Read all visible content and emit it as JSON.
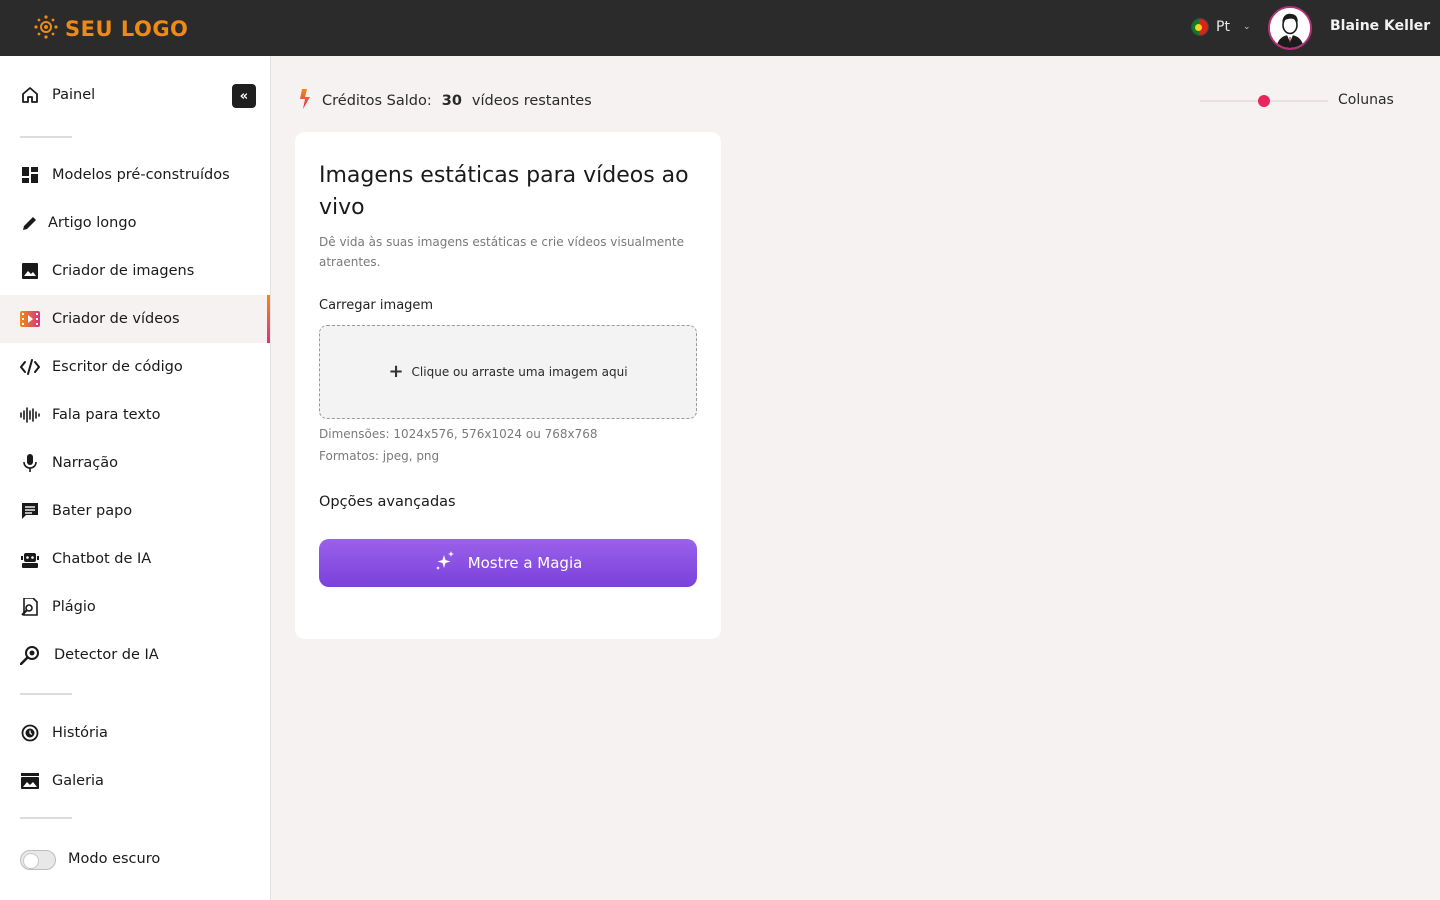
{
  "header": {
    "logo_text": "SEU LOGO",
    "language": "Pt",
    "user_name": "Blaine Keller"
  },
  "sidebar": {
    "items": [
      {
        "label": "Painel",
        "icon": "home-icon"
      },
      {
        "label": "Modelos pré-construídos",
        "icon": "grid-icon"
      },
      {
        "label": "Artigo longo",
        "icon": "pen-icon"
      },
      {
        "label": "Criador de imagens",
        "icon": "image-icon"
      },
      {
        "label": "Criador de vídeos",
        "icon": "video-icon",
        "active": true
      },
      {
        "label": "Escritor de código",
        "icon": "code-icon"
      },
      {
        "label": "Fala para texto",
        "icon": "waveform-icon"
      },
      {
        "label": "Narração",
        "icon": "microphone-icon"
      },
      {
        "label": "Bater papo",
        "icon": "chat-icon"
      },
      {
        "label": "Chatbot de IA",
        "icon": "robot-icon"
      },
      {
        "label": "Plágio",
        "icon": "plagiarism-icon"
      },
      {
        "label": "Detector de IA",
        "icon": "magnifier-icon"
      },
      {
        "label": "História",
        "icon": "history-icon"
      },
      {
        "label": "Galeria",
        "icon": "gallery-icon"
      }
    ],
    "dark_mode_label": "Modo escuro",
    "dark_mode_on": false
  },
  "main": {
    "credits_label": "Créditos Saldo:",
    "credits_value": "30",
    "credits_suffix": "vídeos restantes",
    "columns_label": "Colunas",
    "columns_level": 0.5,
    "card": {
      "title": "Imagens estáticas para vídeos ao vivo",
      "description": "Dê vida às suas imagens estáticas e crie vídeos visualmente atraentes.",
      "upload_label": "Carregar imagem",
      "dropzone_text": "Clique ou arraste uma imagem aqui",
      "dimensions_hint": "Dimensões: 1024x576, 576x1024 ou 768x768",
      "formats_hint": "Formatos: jpeg, png",
      "advanced_label": "Opções avançadas",
      "submit_label": "Mostre a Magia"
    }
  },
  "colors": {
    "accent": "#7a41db",
    "brand": "#f08a17",
    "topbar": "#2b2b2b",
    "slider_thumb": "#e8265e"
  }
}
